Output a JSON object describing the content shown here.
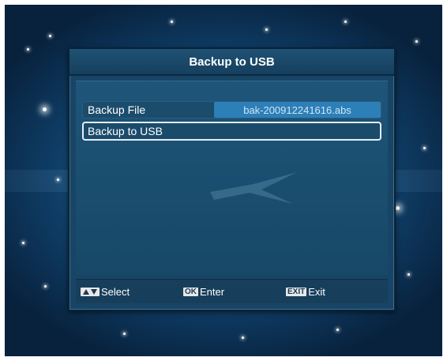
{
  "dialog": {
    "title": "Backup to USB",
    "rows": [
      {
        "label": "Backup File",
        "value": "bak-200912241616.abs"
      },
      {
        "label": "Backup to USB"
      }
    ]
  },
  "footer": {
    "select": {
      "key_icon": "up-down-arrows-icon",
      "label": "Select"
    },
    "enter": {
      "key": "OK",
      "label": "Enter"
    },
    "exit": {
      "key": "EXIT",
      "label": "Exit"
    }
  },
  "colors": {
    "background": "#1a5c8c",
    "panel": "#184566",
    "highlight": "#2d7fb8"
  }
}
